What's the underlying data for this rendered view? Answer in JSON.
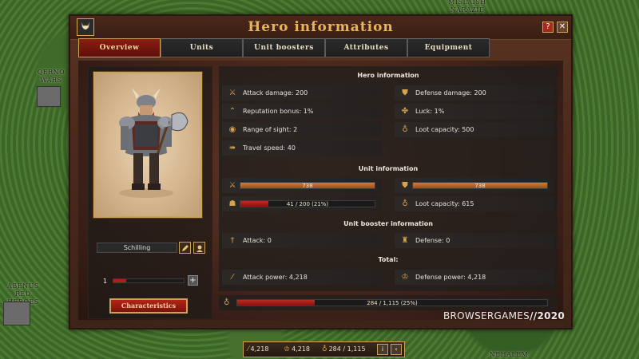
{
  "map": {
    "labels": [
      "MISLAISH NARAZIE",
      "QERNO WARS",
      "ABENUS RED HEROES",
      "NEHALEM"
    ]
  },
  "window": {
    "title": "Hero information",
    "help": "?",
    "close": "✕"
  },
  "tabs": [
    "Overview",
    "Units",
    "Unit boosters",
    "Attributes",
    "Equipment"
  ],
  "hero": {
    "name": "Schilling",
    "level": "1",
    "level_progress": 0.18,
    "characteristics_button": "Characteristics"
  },
  "hero_info": {
    "title": "Hero information",
    "attack_damage": "Attack damage: 200",
    "defense_damage": "Defense damage: 200",
    "reputation_bonus": "Reputation bonus: 1%",
    "luck": "Luck: 1%",
    "range_of_sight": "Range of sight: 2",
    "loot_capacity": "Loot capacity: 500",
    "travel_speed": "Travel speed: 40"
  },
  "unit_info": {
    "title": "Unit information",
    "attack_bar_label": "738",
    "attack_bar_fill": 1.0,
    "defense_bar_label": "738",
    "defense_bar_fill": 1.0,
    "units_bar_label": "41 / 200 (21%)",
    "units_bar_fill": 0.21,
    "loot_capacity": "Loot capacity: 615"
  },
  "booster_info": {
    "title": "Unit booster information",
    "attack": "Attack: 0",
    "defense": "Defense: 0"
  },
  "total": {
    "title": "Total:",
    "attack_power": "Attack power: 4,218",
    "defense_power": "Defense power: 4,218",
    "loot_bar_label": "284 / 1,115 (25%)",
    "loot_bar_fill": 0.25
  },
  "watermark": {
    "brand": "BROWSERGAMES",
    "separator": "//",
    "year": "2020"
  },
  "bottom_bar": {
    "attack": "4,218",
    "defense": "4,218",
    "loot": "284 / 1,115",
    "info_button": "i"
  },
  "colors": {
    "accent_gold": "#c9a35a",
    "title_gold": "#e8b35a",
    "active_tab_red": "#8a1e14",
    "bar_orange": "#d27a3a",
    "bar_red": "#c22a20"
  },
  "icons": {
    "emblem": "hero-helmet-icon",
    "attack": "sword-icon",
    "defense": "shield-icon",
    "reputation": "chevron-rank-icon",
    "luck": "clover-icon",
    "sight": "eye-icon",
    "loot": "sack-icon",
    "speed": "arrows-icon",
    "units": "crowd-icon",
    "booster_attack": "dagger-pair-icon",
    "booster_defense": "armor-icon",
    "total_attack": "sword-diagonal-icon",
    "total_defense": "helmet-shield-icon"
  }
}
